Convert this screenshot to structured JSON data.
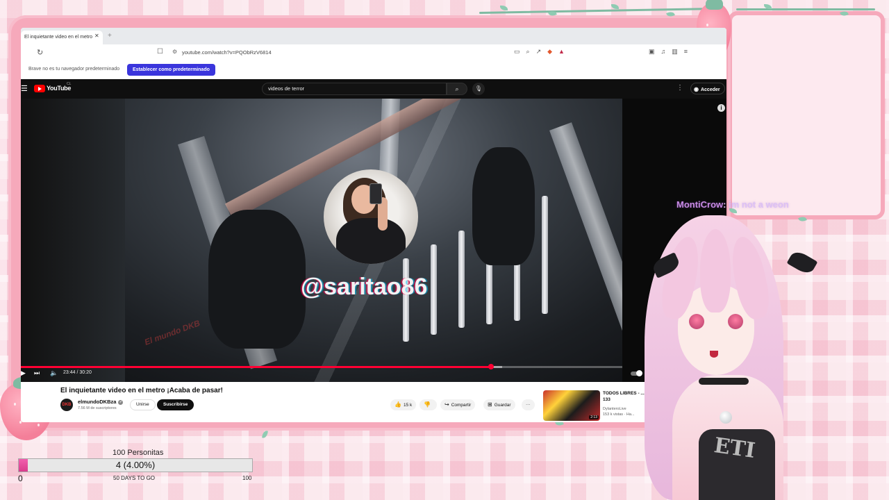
{
  "browser": {
    "tab_title": "El inquietante video en el metro",
    "url": "youtube.com/watch?v=PQObRzV6814",
    "infobar_text": "Brave no es tu navegador predeterminado",
    "set_default_label": "Establecer como predeterminado"
  },
  "youtube": {
    "wordmark": "YouTube",
    "country": "CL",
    "search_query": "videos de terror",
    "signin_label": "Acceder",
    "player": {
      "current_time": "23:44",
      "duration": "30:20",
      "time_display": "23:44 / 30:20",
      "progress_fraction": 0.782,
      "buffered_fraction": 0.8
    },
    "overlay": {
      "handle": "@saritao86",
      "channel_watermark": "El mundo DKB"
    },
    "video_title": "El inquietante video en el metro ¡Acaba de pasar!",
    "channel": {
      "avatar_text": "DKB",
      "name": "elmundoDKBza",
      "subscribers": "7.56 M de suscriptores",
      "join_label": "Unirse",
      "subscribe_label": "Suscribirse"
    },
    "actions": {
      "likes": "15 k",
      "share_label": "Compartir",
      "save_label": "Guardar",
      "more_label": "···"
    },
    "recommended": {
      "title": "TODOS LIBRES - ...RAD 133",
      "channel": "DylanteroLive",
      "meta": "153 k vistas · Ha...",
      "duration": "2:13"
    }
  },
  "chat": {
    "username": "MontiCrow",
    "message": "im not a weon"
  },
  "goal": {
    "title": "100 Personitas",
    "current": 4,
    "target": 100,
    "progress_text": "4 (4.00%)",
    "min_label": "0",
    "max_label": "100",
    "days_label": "50 DAYS TO GO"
  },
  "vtuber": {
    "shirt_text": "ETI"
  },
  "colors": {
    "frame_pink": "#f6a9bb",
    "youtube_red": "#ff0000",
    "progress_red": "#ff0033",
    "goal_fill": "#f25fae",
    "default_button": "#3a35dc"
  }
}
